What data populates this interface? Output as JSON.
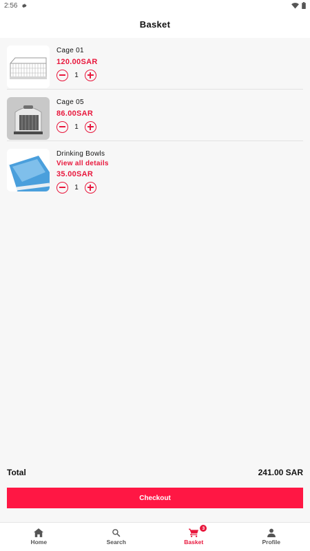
{
  "status_bar": {
    "time": "2:56"
  },
  "header": {
    "title": "Basket"
  },
  "items": [
    {
      "name": "Cage 01",
      "price": "120.00SAR",
      "quantity": "1"
    },
    {
      "name": "Cage 05",
      "price": "86.00SAR",
      "quantity": "1"
    },
    {
      "name": "Drinking Bowls",
      "details_link": "View all details",
      "price": "35.00SAR",
      "quantity": "1"
    }
  ],
  "summary": {
    "total_label": "Total",
    "total_value": "241.00 SAR"
  },
  "checkout": {
    "label": "Checkout"
  },
  "bottom_nav": [
    {
      "label": "Home",
      "icon": "home-icon"
    },
    {
      "label": "Search",
      "icon": "search-icon"
    },
    {
      "label": "Basket",
      "icon": "cart-icon",
      "badge": "3",
      "active": true
    },
    {
      "label": "Profile",
      "icon": "person-icon"
    }
  ],
  "colors": {
    "accent": "#e8173c",
    "button": "#ff1744"
  }
}
